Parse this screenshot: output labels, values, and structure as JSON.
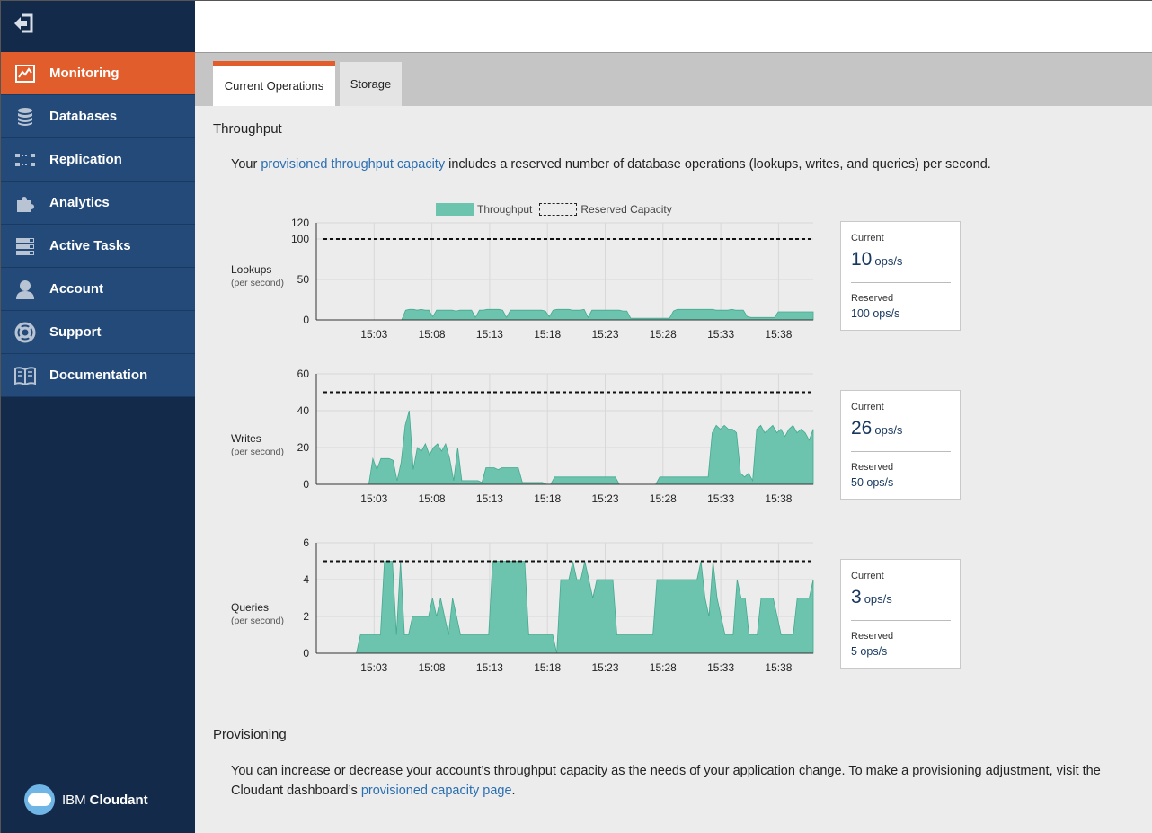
{
  "sidebar": {
    "items": [
      {
        "label": "Monitoring",
        "icon": "line-chart-icon",
        "active": true
      },
      {
        "label": "Databases",
        "icon": "database-icon"
      },
      {
        "label": "Replication",
        "icon": "replication-icon"
      },
      {
        "label": "Analytics",
        "icon": "puzzle-icon"
      },
      {
        "label": "Active Tasks",
        "icon": "tasks-icon"
      },
      {
        "label": "Account",
        "icon": "user-icon"
      },
      {
        "label": "Support",
        "icon": "lifebuoy-icon"
      },
      {
        "label": "Documentation",
        "icon": "book-icon"
      }
    ],
    "logo": {
      "brand": "IBM",
      "product": "Cloudant"
    }
  },
  "tabs": [
    {
      "label": "Current Operations",
      "active": true
    },
    {
      "label": "Storage",
      "active": false
    }
  ],
  "throughput": {
    "heading": "Throughput",
    "intro_prefix": "Your ",
    "intro_link": "provisioned throughput capacity",
    "intro_suffix": " includes a reserved number of database operations (lookups, writes, and queries) per second."
  },
  "legend": {
    "throughput": "Throughput",
    "reserved": "Reserved Capacity"
  },
  "colors": {
    "accent": "#e25d2c",
    "sidebar": "#234a78",
    "fill": "#6cc4ae",
    "link": "#2a6fb2"
  },
  "chart_data": [
    {
      "type": "area",
      "name": "Lookups",
      "subtitle": "(per second)",
      "x_ticks": [
        "15:03",
        "15:08",
        "15:13",
        "15:18",
        "15:23",
        "15:28",
        "15:33",
        "15:38"
      ],
      "ylim": [
        0,
        120
      ],
      "y_ticks": [
        0,
        50,
        100,
        120
      ],
      "reserved": 100,
      "series": [
        {
          "name": "Throughput",
          "values": [
            0,
            0,
            0,
            0,
            0,
            0,
            0,
            0,
            0,
            0,
            0,
            0,
            0,
            0,
            0,
            0,
            0,
            0,
            0,
            0,
            0,
            0,
            0,
            12,
            13,
            13,
            12,
            13,
            12,
            12,
            4,
            12,
            12,
            12,
            12,
            12,
            11,
            12,
            12,
            12,
            12,
            3,
            12,
            12,
            13,
            13,
            13,
            13,
            12,
            3,
            12,
            12,
            12,
            12,
            12,
            12,
            12,
            12,
            12,
            11,
            4,
            12,
            13,
            13,
            13,
            13,
            12,
            12,
            12,
            13,
            3,
            12,
            12,
            12,
            12,
            12,
            12,
            12,
            12,
            11,
            11,
            2,
            2,
            2,
            2,
            2,
            2,
            2,
            2,
            2,
            2,
            2,
            11,
            13,
            13,
            13,
            13,
            13,
            13,
            13,
            13,
            13,
            13,
            12,
            12,
            12,
            12,
            13,
            12,
            12,
            12,
            4,
            3,
            3,
            3,
            3,
            3,
            3,
            3,
            10,
            10,
            10,
            10,
            10,
            10,
            10,
            10,
            10,
            10
          ]
        }
      ]
    },
    {
      "type": "area",
      "name": "Writes",
      "subtitle": "(per second)",
      "x_ticks": [
        "15:03",
        "15:08",
        "15:13",
        "15:18",
        "15:23",
        "15:28",
        "15:33",
        "15:38"
      ],
      "ylim": [
        0,
        60
      ],
      "y_ticks": [
        0,
        20,
        40,
        60
      ],
      "reserved": 50,
      "series": [
        {
          "name": "Throughput",
          "values": [
            0,
            0,
            0,
            0,
            0,
            0,
            0,
            0,
            0,
            0,
            0,
            0,
            0,
            0,
            14,
            8,
            14,
            14,
            14,
            13,
            2,
            12,
            32,
            40,
            8,
            20,
            18,
            22,
            16,
            20,
            22,
            18,
            22,
            14,
            2,
            20,
            2,
            2,
            2,
            2,
            2,
            1,
            9,
            9,
            9,
            8,
            9,
            9,
            9,
            9,
            9,
            1,
            1,
            1,
            1,
            1,
            1,
            0,
            0,
            4,
            4,
            4,
            4,
            4,
            4,
            4,
            4,
            4,
            4,
            4,
            4,
            4,
            4,
            4,
            4,
            0,
            0,
            0,
            0,
            0,
            0,
            0,
            0,
            0,
            0,
            4,
            4,
            4,
            4,
            4,
            4,
            4,
            4,
            4,
            4,
            4,
            4,
            4,
            28,
            32,
            30,
            32,
            30,
            30,
            28,
            6,
            4,
            6,
            2,
            30,
            32,
            28,
            30,
            32,
            28,
            30,
            26,
            30,
            32,
            28,
            30,
            28,
            24,
            30
          ]
        }
      ]
    },
    {
      "type": "area",
      "name": "Queries",
      "subtitle": "(per second)",
      "x_ticks": [
        "15:03",
        "15:08",
        "15:13",
        "15:18",
        "15:23",
        "15:28",
        "15:33",
        "15:38"
      ],
      "ylim": [
        0,
        6
      ],
      "y_ticks": [
        0,
        2,
        4,
        6
      ],
      "reserved": 5,
      "series": [
        {
          "name": "Throughput",
          "values": [
            0,
            0,
            0,
            0,
            0,
            0,
            0,
            0,
            0,
            0,
            0,
            1,
            1,
            1,
            1,
            1,
            1,
            5,
            5,
            5,
            1,
            5,
            1,
            1,
            2,
            2,
            2,
            2,
            2,
            3,
            2,
            3,
            2,
            1,
            3,
            2,
            1,
            1,
            1,
            1,
            1,
            1,
            1,
            1,
            5,
            5,
            5,
            5,
            5,
            5,
            5,
            5,
            5,
            1,
            1,
            1,
            1,
            1,
            1,
            1,
            0,
            4,
            4,
            4,
            5,
            4,
            4,
            5,
            4,
            3,
            4,
            4,
            4,
            4,
            4,
            1,
            1,
            1,
            1,
            1,
            1,
            1,
            1,
            1,
            1,
            4,
            4,
            4,
            4,
            4,
            4,
            4,
            4,
            4,
            4,
            4,
            5,
            3,
            2,
            5,
            3,
            2,
            1,
            1,
            1,
            4,
            3,
            3,
            1,
            1,
            1,
            3,
            3,
            3,
            3,
            2,
            1,
            1,
            1,
            1,
            3,
            3,
            3,
            3,
            4
          ]
        }
      ]
    }
  ],
  "stats": [
    {
      "current_label": "Current",
      "current_value": "10",
      "unit": "ops/s",
      "reserved_label": "Reserved",
      "reserved_value": "100 ops/s"
    },
    {
      "current_label": "Current",
      "current_value": "26",
      "unit": "ops/s",
      "reserved_label": "Reserved",
      "reserved_value": "50 ops/s"
    },
    {
      "current_label": "Current",
      "current_value": "3",
      "unit": "ops/s",
      "reserved_label": "Reserved",
      "reserved_value": "5 ops/s"
    }
  ],
  "provisioning": {
    "heading": "Provisioning",
    "text_prefix": "You can increase or decrease your account’s throughput capacity as the needs of your application change. To make a provisioning adjustment, visit the Cloudant dashboard’s ",
    "link": "provisioned capacity page",
    "text_suffix": "."
  }
}
